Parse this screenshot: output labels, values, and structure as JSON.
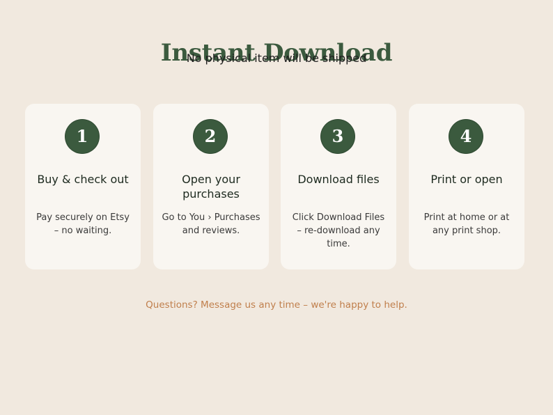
{
  "header": {
    "title": "Instant Download",
    "subtitle": "No physical item will be shipped"
  },
  "steps": [
    {
      "number": "1",
      "title": "Buy & check out",
      "description": "Pay securely on Etsy – no waiting."
    },
    {
      "number": "2",
      "title": "Open your purchases",
      "description": "Go to You › Purchases and reviews."
    },
    {
      "number": "3",
      "title": "Download files",
      "description": "Click Download Files – re-download any time."
    },
    {
      "number": "4",
      "title": "Print or open",
      "description": "Print at home or at any print shop."
    }
  ],
  "footer": {
    "text": "Questions? Message us any time – we're happy to help."
  },
  "colors": {
    "background": "#f1e9df",
    "card": "#f9f6f1",
    "accent_green": "#3b5a3e",
    "footer_text": "#c07f4c"
  }
}
